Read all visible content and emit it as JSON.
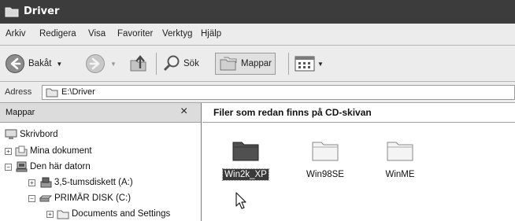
{
  "window": {
    "title": "Driver"
  },
  "menu": [
    "Arkiv",
    "Redigera",
    "Visa",
    "Favoriter",
    "Verktyg",
    "Hjälp"
  ],
  "toolbar": {
    "back_label": "Bakåt",
    "search_label": "Sök",
    "folders_label": "Mappar"
  },
  "address": {
    "label": "Adress",
    "value": "E:\\Driver"
  },
  "folders_pane": {
    "title": "Mappar",
    "close_glyph": "×",
    "tree": [
      {
        "label": "Skrivbord",
        "icon": "desktop-icon"
      },
      {
        "label": "Mina dokument",
        "icon": "my-documents-icon",
        "expander": "+"
      },
      {
        "label": "Den här datorn",
        "icon": "my-computer-icon",
        "expander": "−"
      },
      {
        "label": "3,5-tumsdiskett (A:)",
        "icon": "floppy-icon",
        "expander": "+"
      },
      {
        "label": "PRIMÄR DISK (C:)",
        "icon": "hard-disk-icon",
        "expander": "−"
      },
      {
        "label": "Documents and Settings",
        "icon": "folder-icon",
        "expander": "+"
      }
    ]
  },
  "content": {
    "header": "Filer som redan finns på CD-skivan",
    "items": [
      {
        "label": "Win2k_XP",
        "selected": true
      },
      {
        "label": "Win98SE",
        "selected": false
      },
      {
        "label": "WinME",
        "selected": false
      }
    ]
  },
  "colors": {
    "titlebar": "#3c3c3c",
    "selection": "#3a3a3a"
  }
}
